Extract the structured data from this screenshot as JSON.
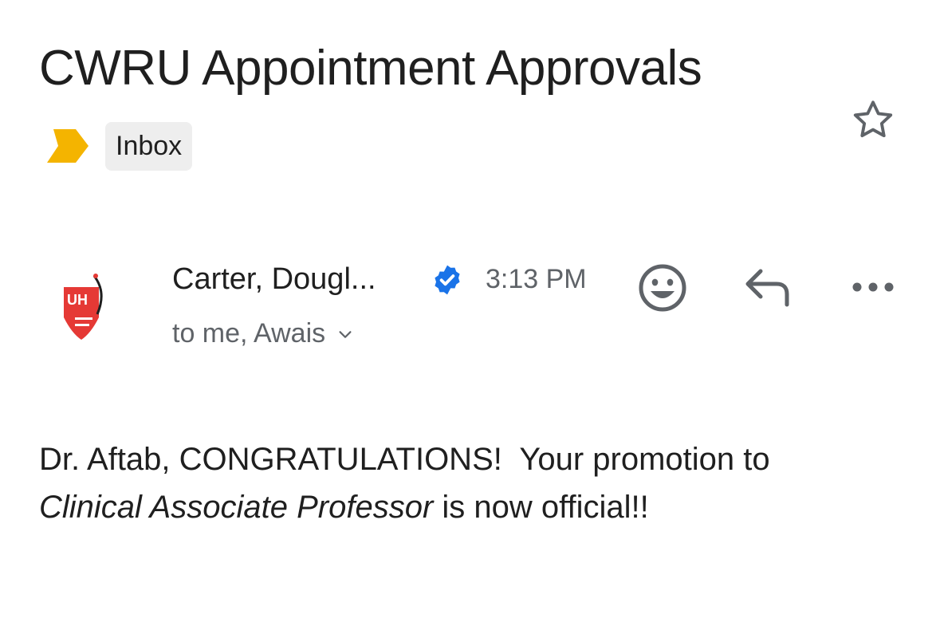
{
  "email": {
    "subject": "CWRU Appointment Approvals",
    "label": "Inbox",
    "starred": false,
    "sender": {
      "name": "Carter, Dougl...",
      "verified": true,
      "avatar_text": "UH"
    },
    "time": "3:13 PM",
    "recipients": "to me, Awais",
    "body": {
      "line1": "Dr. Aftab, CONGRATULATIONS!  Your promotion to",
      "italic_title": "Clinical Associate Professor",
      "line2_rest": " is now official!!"
    }
  },
  "icons": {
    "star": "star-outline-icon",
    "importance": "importance-marker-icon",
    "verified": "verified-badge-icon",
    "emoji": "add-reaction-icon",
    "reply": "reply-icon",
    "more": "more-horizontal-icon",
    "chevron": "chevron-down-icon"
  },
  "colors": {
    "importance_marker": "#F4B400",
    "verified_badge": "#1A73E8",
    "avatar_red": "#E53935",
    "icon_gray": "#5f6368"
  }
}
